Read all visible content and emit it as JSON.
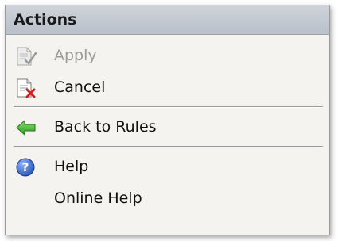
{
  "panel": {
    "title": "Actions"
  },
  "actions": {
    "apply": {
      "label": "Apply",
      "icon": "document-check-icon",
      "enabled": false
    },
    "cancel": {
      "label": "Cancel",
      "icon": "document-cancel-icon",
      "enabled": true
    },
    "back_to_rules": {
      "label": "Back to Rules",
      "icon": "green-back-arrow-icon",
      "enabled": true
    },
    "help": {
      "label": "Help",
      "icon": "help-icon",
      "enabled": true
    },
    "online_help": {
      "label": "Online Help",
      "enabled": true
    }
  },
  "colors": {
    "header_bg": "#c4cad2",
    "panel_bg": "#f4f3ef",
    "disabled_text": "#9a9a9a",
    "cancel_x": "#d11f1f",
    "arrow_green": "#3cb528",
    "help_blue": "#2b5fc4"
  }
}
